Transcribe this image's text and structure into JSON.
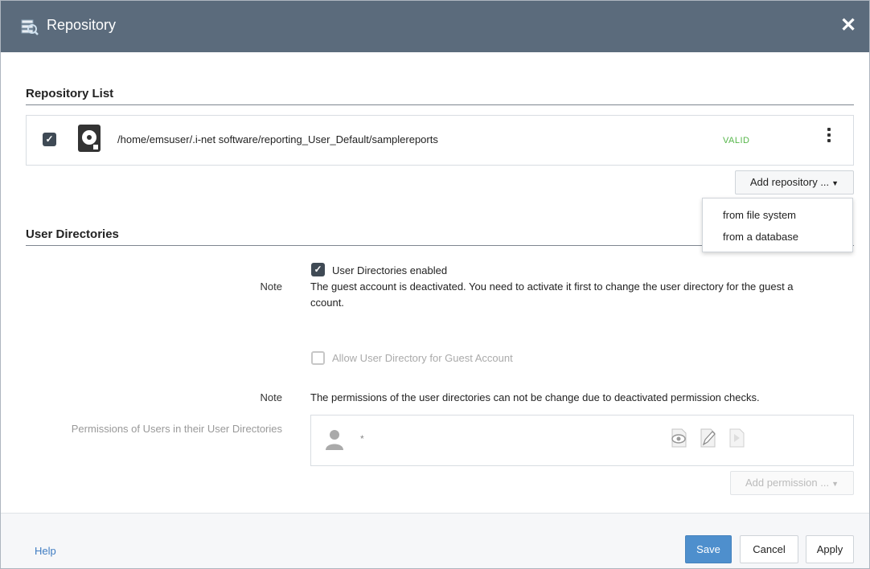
{
  "window": {
    "title": "Repository",
    "close_icon": "close-icon"
  },
  "repository_list": {
    "title": "Repository List",
    "items": [
      {
        "checked": true,
        "path": "/home/emsuser/.i-net software/reporting_User_Default/samplereports",
        "status": "VALID",
        "status_color": "#56b64a"
      }
    ],
    "add_button_label": "Add repository ...",
    "add_menu": [
      "from file system",
      "from a database"
    ]
  },
  "user_directories": {
    "title": "User Directories",
    "enabled_label": "User Directories enabled",
    "enabled": true,
    "note1_label": "Note",
    "note1_text_line1": "The guest account is deactivated. You need to activate it first to change the user directory for the guest a",
    "note1_text_line2": "ccount.",
    "guest_label": "Allow User Directory for Guest Account",
    "guest_checked": false,
    "note2_label": "Note",
    "note2_text": "The permissions of the user directories can not be change due to deactivated permission checks.",
    "permissions_label": "Permissions of Users in their User Directories",
    "permission_entries": [
      {
        "user": "*"
      }
    ],
    "add_permission_label": "Add permission ..."
  },
  "footer": {
    "help_label": "Help",
    "save_label": "Save",
    "cancel_label": "Cancel",
    "apply_label": "Apply"
  },
  "colors": {
    "titlebar": "#5b6b7c",
    "accent": "#4e8fcd",
    "valid": "#56b64a",
    "link": "#3f7cc2"
  }
}
